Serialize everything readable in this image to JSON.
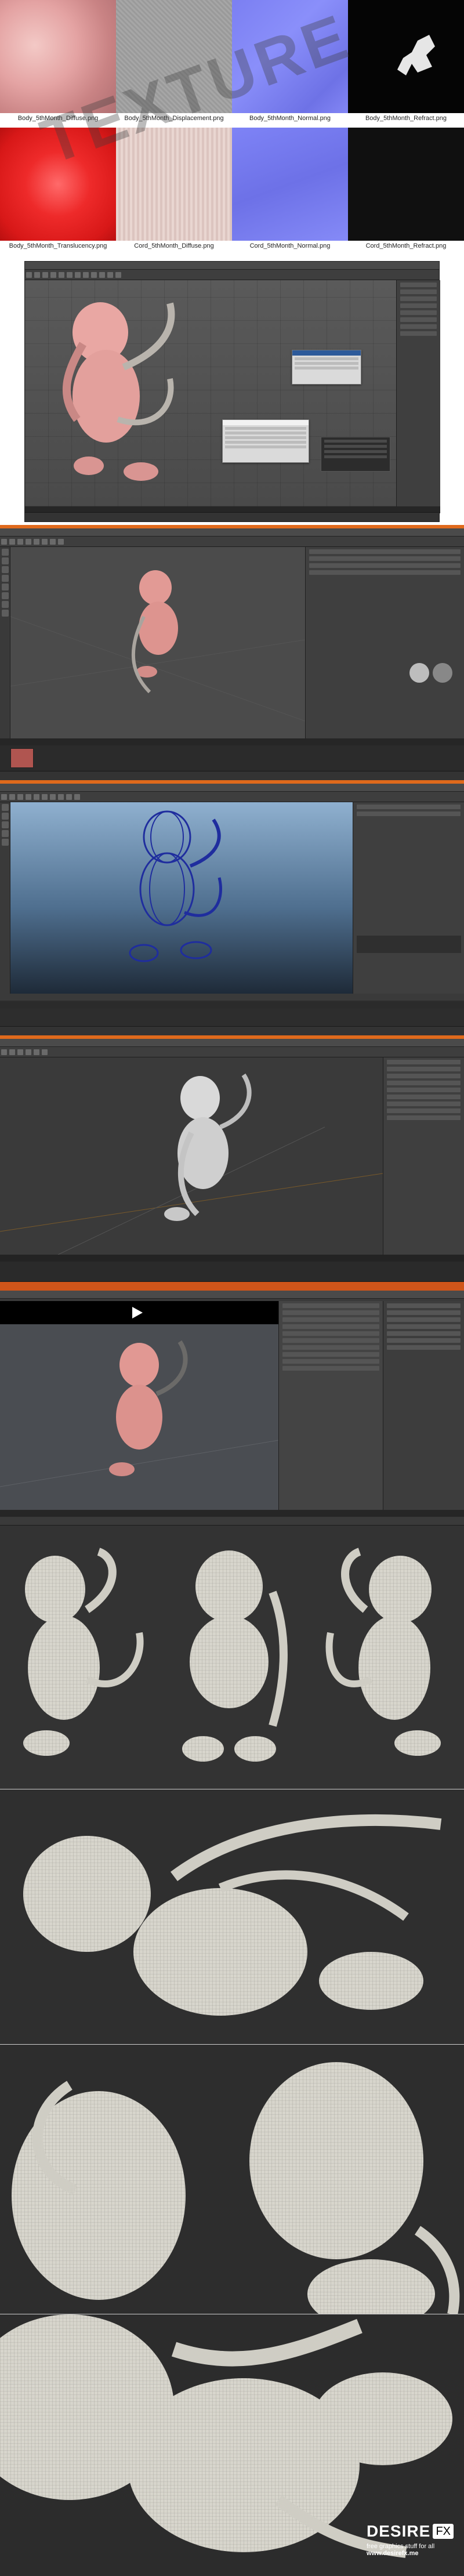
{
  "textures": [
    {
      "caption": "Body_5thMonth_Diffuse.png"
    },
    {
      "caption": "Body_5thMonth_Displacement.png"
    },
    {
      "caption": "Body_5thMonth_Normal.png"
    },
    {
      "caption": "Body_5thMonth_Refract.png"
    },
    {
      "caption": "Body_5thMonth_Translucency.png"
    },
    {
      "caption": "Cord_5thMonth_Diffuse.png"
    },
    {
      "caption": "Cord_5thMonth_Normal.png"
    },
    {
      "caption": "Cord_5thMonth_Refract.png"
    }
  ],
  "watermark": "TEXTURE",
  "logo": {
    "word": "DESIRE",
    "fx": "FX",
    "tagline": "free graphics stuff for all",
    "site": "www.desirefx.me"
  },
  "colors": {
    "skin": "#e9a7a3",
    "skin_dark": "#c6807f",
    "wire_gray": "#d7d5cc",
    "maya_wire": "#1f2d9e",
    "orange_accent": "#e06a1c"
  }
}
